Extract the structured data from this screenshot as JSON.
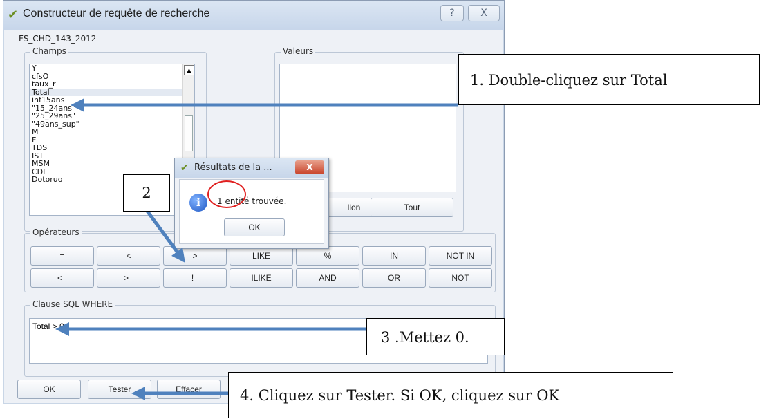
{
  "window": {
    "title": "Constructeur de requête de recherche",
    "help_glyph": "?",
    "close_glyph": "X",
    "layer_name": "FS_CHD_143_2012"
  },
  "fields": {
    "label": "Champs",
    "items": [
      "Y",
      "cfsO",
      "taux_r",
      "Total",
      "inf15ans",
      "\"15_24ans\"",
      "\"25_29ans\"",
      "\"49ans_sup\"",
      "M",
      "F",
      "TDS",
      "IST",
      "MSM",
      "CDI",
      "Dotoruo"
    ],
    "selected": "Total",
    "scroll_up_glyph": "▲"
  },
  "values": {
    "label": "Valeurs",
    "sample_button": "llon",
    "all_button": "Tout"
  },
  "operators": {
    "label": "Opérateurs",
    "row1": [
      "=",
      "<",
      ">",
      "LIKE",
      "%",
      "IN",
      "NOT IN"
    ],
    "row2": [
      "<=",
      ">=",
      "!=",
      "ILIKE",
      "AND",
      "OR",
      "NOT"
    ]
  },
  "clause": {
    "label": "Clause SQL WHERE",
    "text": "Total > 0"
  },
  "bottom_buttons": {
    "ok": "OK",
    "test": "Tester",
    "clear": "Effacer"
  },
  "popup": {
    "title": "Résultats de la ...",
    "close_glyph": "X",
    "message": "1 entité trouvée.",
    "ok": "OK",
    "info_glyph": "i"
  },
  "callouts": {
    "c1": "1.   Double-cliquez sur Total",
    "c2": "2",
    "c3": "3 .Mettez 0.",
    "c4": "4. Cliquez sur Tester. Si OK, cliquez sur OK"
  },
  "colors": {
    "arrow": "#4f81bd",
    "highlight_circle": "#e02020"
  }
}
